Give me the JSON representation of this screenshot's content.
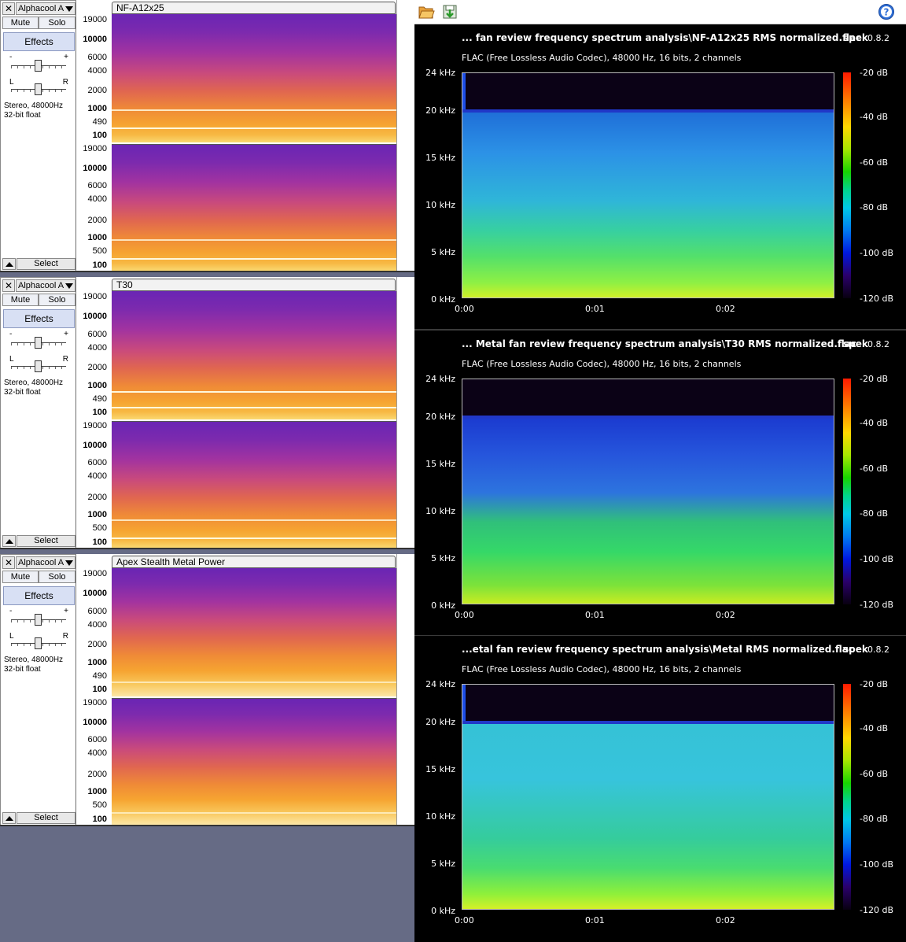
{
  "audacity": {
    "common": {
      "close_glyph": "✕",
      "mute_label": "Mute",
      "solo_label": "Solo",
      "effects_label": "Effects",
      "gain_minus": "-",
      "gain_plus": "+",
      "pan_left": "L",
      "pan_right": "R",
      "format_line1": "Stereo, 48000Hz",
      "format_line2": "32-bit float",
      "select_label": "Select"
    },
    "tracks": [
      {
        "menu_name": "Alphacool A",
        "clip_name": "NF-A12x25"
      },
      {
        "menu_name": "Alphacool A",
        "clip_name": "T30"
      },
      {
        "menu_name": "Alphacool A",
        "clip_name": "Apex Stealth Metal Power"
      }
    ],
    "ruler_labels": [
      "19000",
      "10000",
      "6000",
      "4000",
      "2000",
      "1000",
      "490",
      "100"
    ],
    "ruler_labels_lower": [
      "19000",
      "10000",
      "6000",
      "4000",
      "2000",
      "1000",
      "500",
      "100"
    ]
  },
  "spek": {
    "toolbar": {
      "open_icon": "folder-open-icon",
      "save_icon": "save-icon",
      "help_icon": "help-icon",
      "help_glyph": "?"
    },
    "app_name": "spek",
    "version": "0.8.2",
    "subtitle": "FLAC (Free Lossless Audio Codec), 48000 Hz, 16 bits, 2 channels",
    "freq_labels": [
      "24 kHz",
      "20 kHz",
      "15 kHz",
      "10 kHz",
      "5 kHz",
      "0 kHz"
    ],
    "time_labels": [
      "0:00",
      "0:01",
      "0:02"
    ],
    "db_labels": [
      "-20 dB",
      "-40 dB",
      "-60 dB",
      "-80 dB",
      "-100 dB",
      "-120 dB"
    ],
    "panels": [
      {
        "title": "... fan review frequency spectrum analysis\\NF-A12x25 RMS normalized.flac"
      },
      {
        "title": "... Metal fan review frequency spectrum analysis\\T30 RMS normalized.flac"
      },
      {
        "title": "...etal fan review frequency spectrum analysis\\Metal RMS normalized.flac"
      }
    ]
  }
}
